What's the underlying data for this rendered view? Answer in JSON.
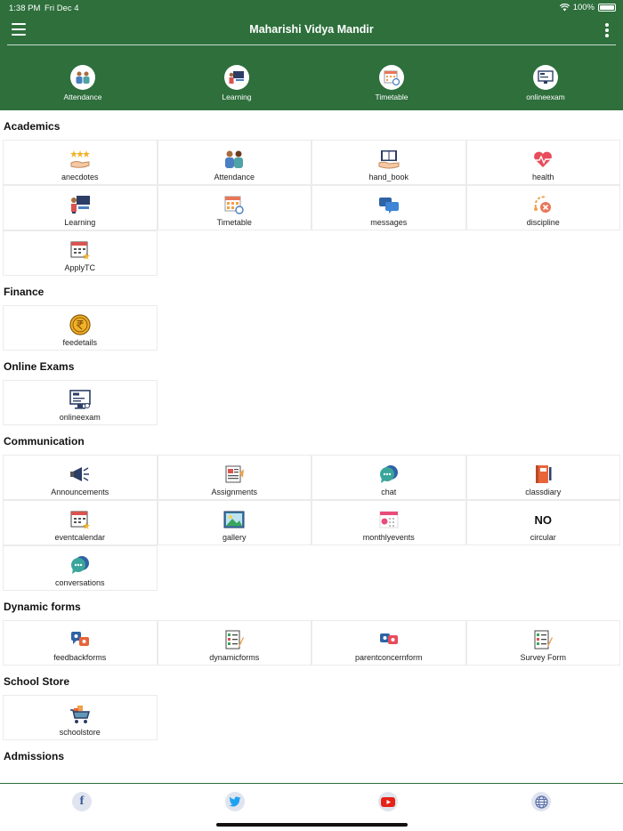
{
  "status": {
    "time": "1:38 PM",
    "date": "Fri Dec 4",
    "battery": "100%"
  },
  "app": {
    "title": "Maharishi Vidya Mandir"
  },
  "quick_actions": [
    {
      "label": "Attendance",
      "icon": "attendance-icon"
    },
    {
      "label": "Learning",
      "icon": "learning-icon"
    },
    {
      "label": "Timetable",
      "icon": "timetable-icon"
    },
    {
      "label": "onlineexam",
      "icon": "onlineexam-icon"
    }
  ],
  "sections": [
    {
      "title": "Academics",
      "items": [
        {
          "label": "anecdotes",
          "icon": "anecdotes-icon"
        },
        {
          "label": "Attendance",
          "icon": "attendance-icon"
        },
        {
          "label": "hand_book",
          "icon": "handbook-icon"
        },
        {
          "label": "health",
          "icon": "health-icon"
        },
        {
          "label": "Learning",
          "icon": "learning-icon"
        },
        {
          "label": "Timetable",
          "icon": "timetable-icon"
        },
        {
          "label": "messages",
          "icon": "messages-icon"
        },
        {
          "label": "discipline",
          "icon": "discipline-icon"
        },
        {
          "label": "ApplyTC",
          "icon": "applytc-icon"
        }
      ]
    },
    {
      "title": "Finance",
      "items": [
        {
          "label": "feedetails",
          "icon": "rupee-icon"
        }
      ]
    },
    {
      "title": "Online Exams",
      "items": [
        {
          "label": "onlineexam",
          "icon": "onlineexam-icon"
        }
      ]
    },
    {
      "title": "Communication",
      "items": [
        {
          "label": "Announcements",
          "icon": "megaphone-icon"
        },
        {
          "label": "Assignments",
          "icon": "assignments-icon"
        },
        {
          "label": "chat",
          "icon": "chat-icon"
        },
        {
          "label": "classdiary",
          "icon": "diary-icon"
        },
        {
          "label": "eventcalendar",
          "icon": "calendar-icon"
        },
        {
          "label": "gallery",
          "icon": "gallery-icon"
        },
        {
          "label": "monthlyevents",
          "icon": "monthly-calendar-icon"
        },
        {
          "label": "circular",
          "icon": "no-image-icon",
          "icon_text": "NO"
        },
        {
          "label": "conversations",
          "icon": "conversations-icon"
        }
      ]
    },
    {
      "title": "Dynamic forms",
      "items": [
        {
          "label": "feedbackforms",
          "icon": "feedback-icon"
        },
        {
          "label": "dynamicforms",
          "icon": "forms-icon"
        },
        {
          "label": "parentconcernform",
          "icon": "parent-concern-icon"
        },
        {
          "label": "Survey Form",
          "icon": "survey-icon"
        }
      ]
    },
    {
      "title": "School Store",
      "items": [
        {
          "label": "schoolstore",
          "icon": "cart-icon"
        }
      ]
    },
    {
      "title": "Admissions",
      "items": []
    }
  ],
  "social": [
    {
      "name": "facebook-icon",
      "glyph": "f",
      "color": "#3b5998"
    },
    {
      "name": "twitter-icon",
      "glyph": "",
      "color": "#1da1f2"
    },
    {
      "name": "youtube-icon",
      "glyph": "",
      "color": "#e62117"
    },
    {
      "name": "globe-icon",
      "glyph": "",
      "color": "#5b6fa8"
    }
  ],
  "colors": {
    "header": "#2e6f3c",
    "tile_border": "#ebebeb"
  }
}
